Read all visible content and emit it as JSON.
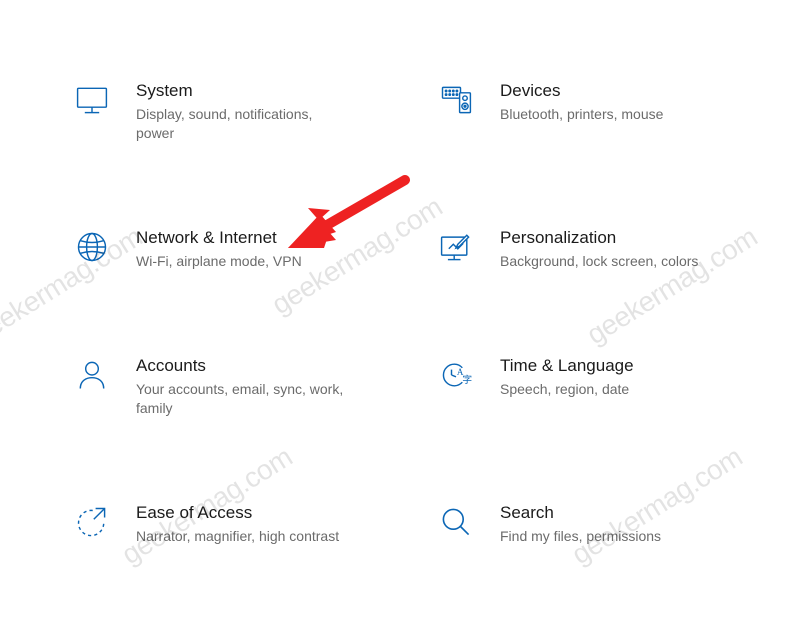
{
  "settings": {
    "items": [
      {
        "id": "system",
        "title": "System",
        "desc": "Display, sound, notifications, power"
      },
      {
        "id": "devices",
        "title": "Devices",
        "desc": "Bluetooth, printers, mouse"
      },
      {
        "id": "network",
        "title": "Network & Internet",
        "desc": "Wi-Fi, airplane mode, VPN"
      },
      {
        "id": "personalization",
        "title": "Personalization",
        "desc": "Background, lock screen, colors"
      },
      {
        "id": "accounts",
        "title": "Accounts",
        "desc": "Your accounts, email, sync, work, family"
      },
      {
        "id": "time-language",
        "title": "Time & Language",
        "desc": "Speech, region, date"
      },
      {
        "id": "ease-of-access",
        "title": "Ease of Access",
        "desc": "Narrator, magnifier, high contrast"
      },
      {
        "id": "search",
        "title": "Search",
        "desc": "Find my files, permissions"
      }
    ]
  },
  "watermark": {
    "text": "geekermag.com"
  },
  "colors": {
    "icon": "#0b66b5",
    "arrow": "#ee2222"
  }
}
